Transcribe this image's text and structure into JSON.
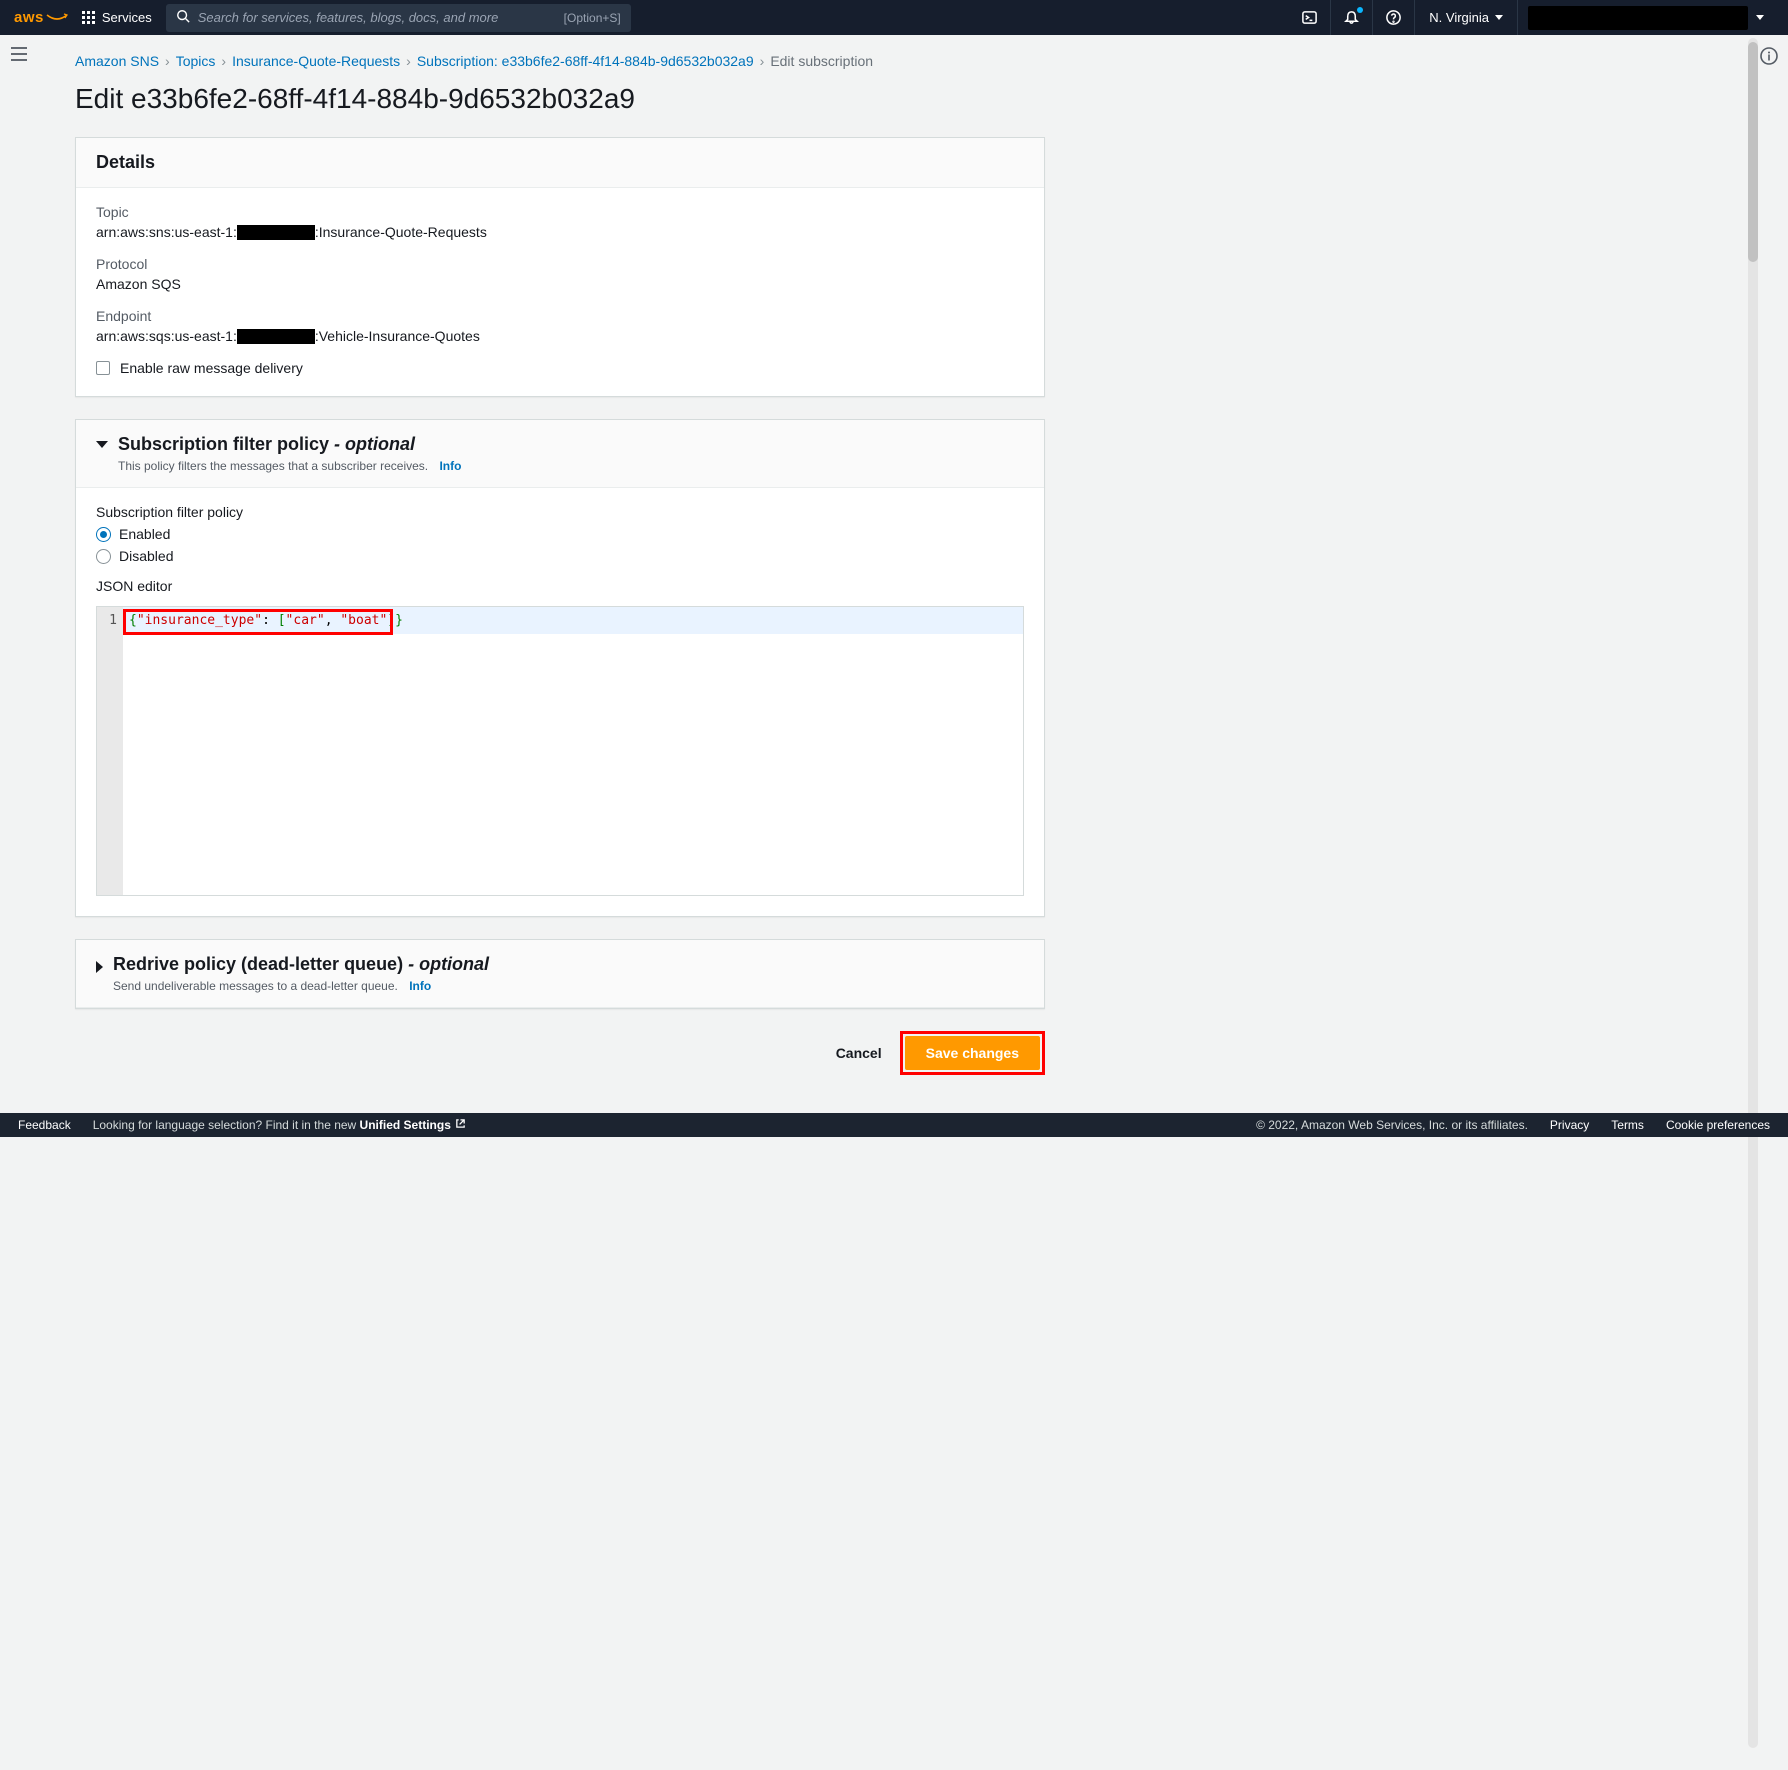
{
  "nav": {
    "logo_text": "aws",
    "services_label": "Services",
    "search_placeholder": "Search for services, features, blogs, docs, and more",
    "search_shortcut": "[Option+S]",
    "region": "N. Virginia"
  },
  "breadcrumbs": {
    "items": [
      {
        "label": "Amazon SNS"
      },
      {
        "label": "Topics"
      },
      {
        "label": "Insurance-Quote-Requests"
      },
      {
        "label": "Subscription: e33b6fe2-68ff-4f14-884b-9d6532b032a9"
      }
    ],
    "current": "Edit subscription"
  },
  "page_title": "Edit e33b6fe2-68ff-4f14-884b-9d6532b032a9",
  "details": {
    "heading": "Details",
    "topic_label": "Topic",
    "topic_prefix": "arn:aws:sns:us-east-1:",
    "topic_suffix": ":Insurance-Quote-Requests",
    "protocol_label": "Protocol",
    "protocol_value": "Amazon SQS",
    "endpoint_label": "Endpoint",
    "endpoint_prefix": "arn:aws:sqs:us-east-1:",
    "endpoint_suffix": ":Vehicle-Insurance-Quotes",
    "raw_delivery_label": "Enable raw message delivery"
  },
  "filter_policy": {
    "heading": "Subscription filter policy",
    "optional_suffix": " - optional",
    "description": "This policy filters the messages that a subscriber receives.",
    "info_link": "Info",
    "group_label": "Subscription filter policy",
    "enabled_label": "Enabled",
    "disabled_label": "Disabled",
    "editor_label": "JSON editor",
    "editor_line_number": "1",
    "code": {
      "open": "{",
      "key": "\"insurance_type\"",
      "colon": ": ",
      "open_arr": "[",
      "v1": "\"car\"",
      "comma": ", ",
      "v2": "\"boat\"",
      "close_arr": "]",
      "close": "}"
    }
  },
  "redrive": {
    "heading": "Redrive policy (dead-letter queue)",
    "optional_suffix": " - optional",
    "description": "Send undeliverable messages to a dead-letter queue.",
    "info_link": "Info"
  },
  "actions": {
    "cancel": "Cancel",
    "save": "Save changes"
  },
  "footer": {
    "feedback": "Feedback",
    "lang_prompt": "Looking for language selection? Find it in the new ",
    "lang_link": "Unified Settings",
    "copyright": "© 2022, Amazon Web Services, Inc. or its affiliates.",
    "privacy": "Privacy",
    "terms": "Terms",
    "cookies": "Cookie preferences"
  }
}
